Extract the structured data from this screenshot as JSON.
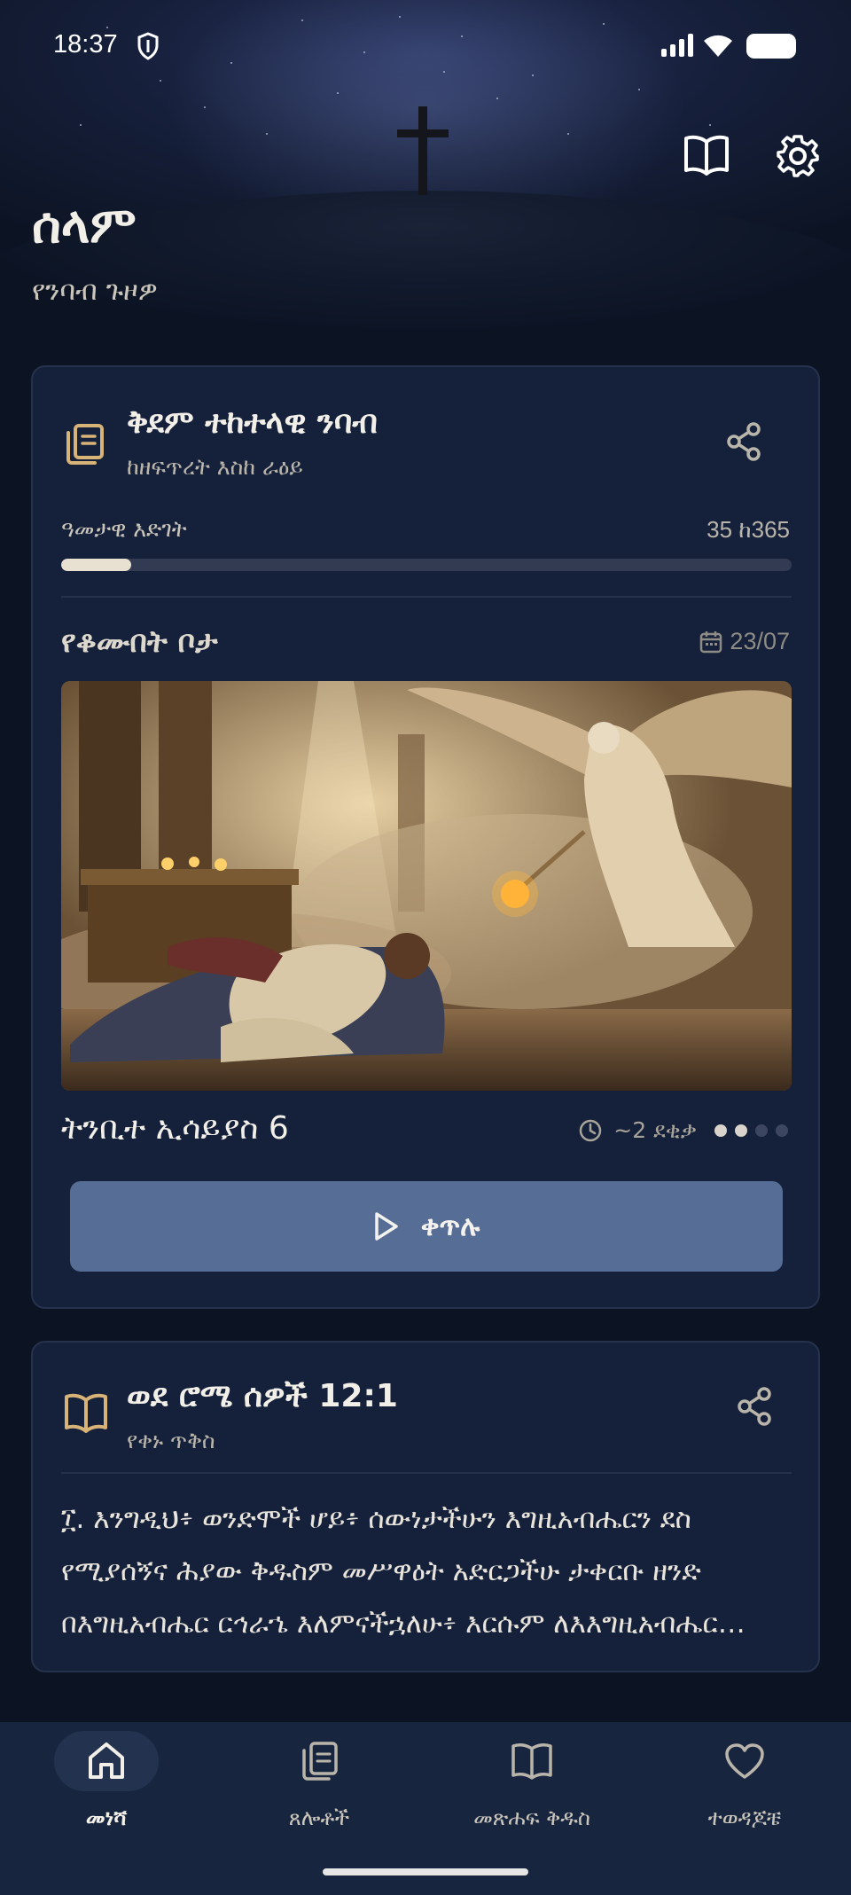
{
  "status_bar": {
    "time": "18:37"
  },
  "header": {
    "greeting": "ሰላም",
    "subtitle": "የንባብ ጉዞዎ",
    "icons": [
      "book-icon",
      "gear-icon"
    ]
  },
  "plan_card": {
    "title": "ቅደም ተከተላዊ ንባብ",
    "subtitle": "ከዘፍጥረት እስከ ራዕይ",
    "progress_label": "ዓመታዊ እድገት",
    "progress_count": "35 ከ365",
    "progress_fraction": 0.096,
    "section_title": "የቆሙበት ቦታ",
    "date": "23/07",
    "reading_title": "ትንቢተ ኢሳይያስ 6",
    "duration": "~2 ደቂቃ",
    "dots": [
      true,
      true,
      false,
      false
    ],
    "continue_label": "ቀጥሉ",
    "accent_color": "#d8b378"
  },
  "verse_card": {
    "reference": "ወደ ሮሜ ሰዎች 12:1",
    "subtitle": "የቀኑ ጥቅስ",
    "text": "፲. እንግዲህ፥ ወንድሞች ሆይ፥ ሰውነታችሁን እግዚአብሔርን ደስ የሚያሰኝና ሕያው ቅዱስም መሥዋዕት አድርጋችሁ ታቀርቡ ዘንድ በእግዚአብሔር ርኅራኄ እለምናችኋለሁ፥ እርሱም ለእእግዚአብሔር የምታቀርቡት ምክንያታዊ አምልኮአችሁ ነው።"
  },
  "bottom_nav": {
    "items": [
      {
        "label": "መነሻ",
        "icon": "home-icon",
        "active": true
      },
      {
        "label": "ጸሎቶች",
        "icon": "prayers-icon",
        "active": false
      },
      {
        "label": "መጽሐፍ ቅዱስ",
        "icon": "bible-icon",
        "active": false
      },
      {
        "label": "ተወዳጆቼ",
        "icon": "heart-icon",
        "active": false
      }
    ]
  }
}
